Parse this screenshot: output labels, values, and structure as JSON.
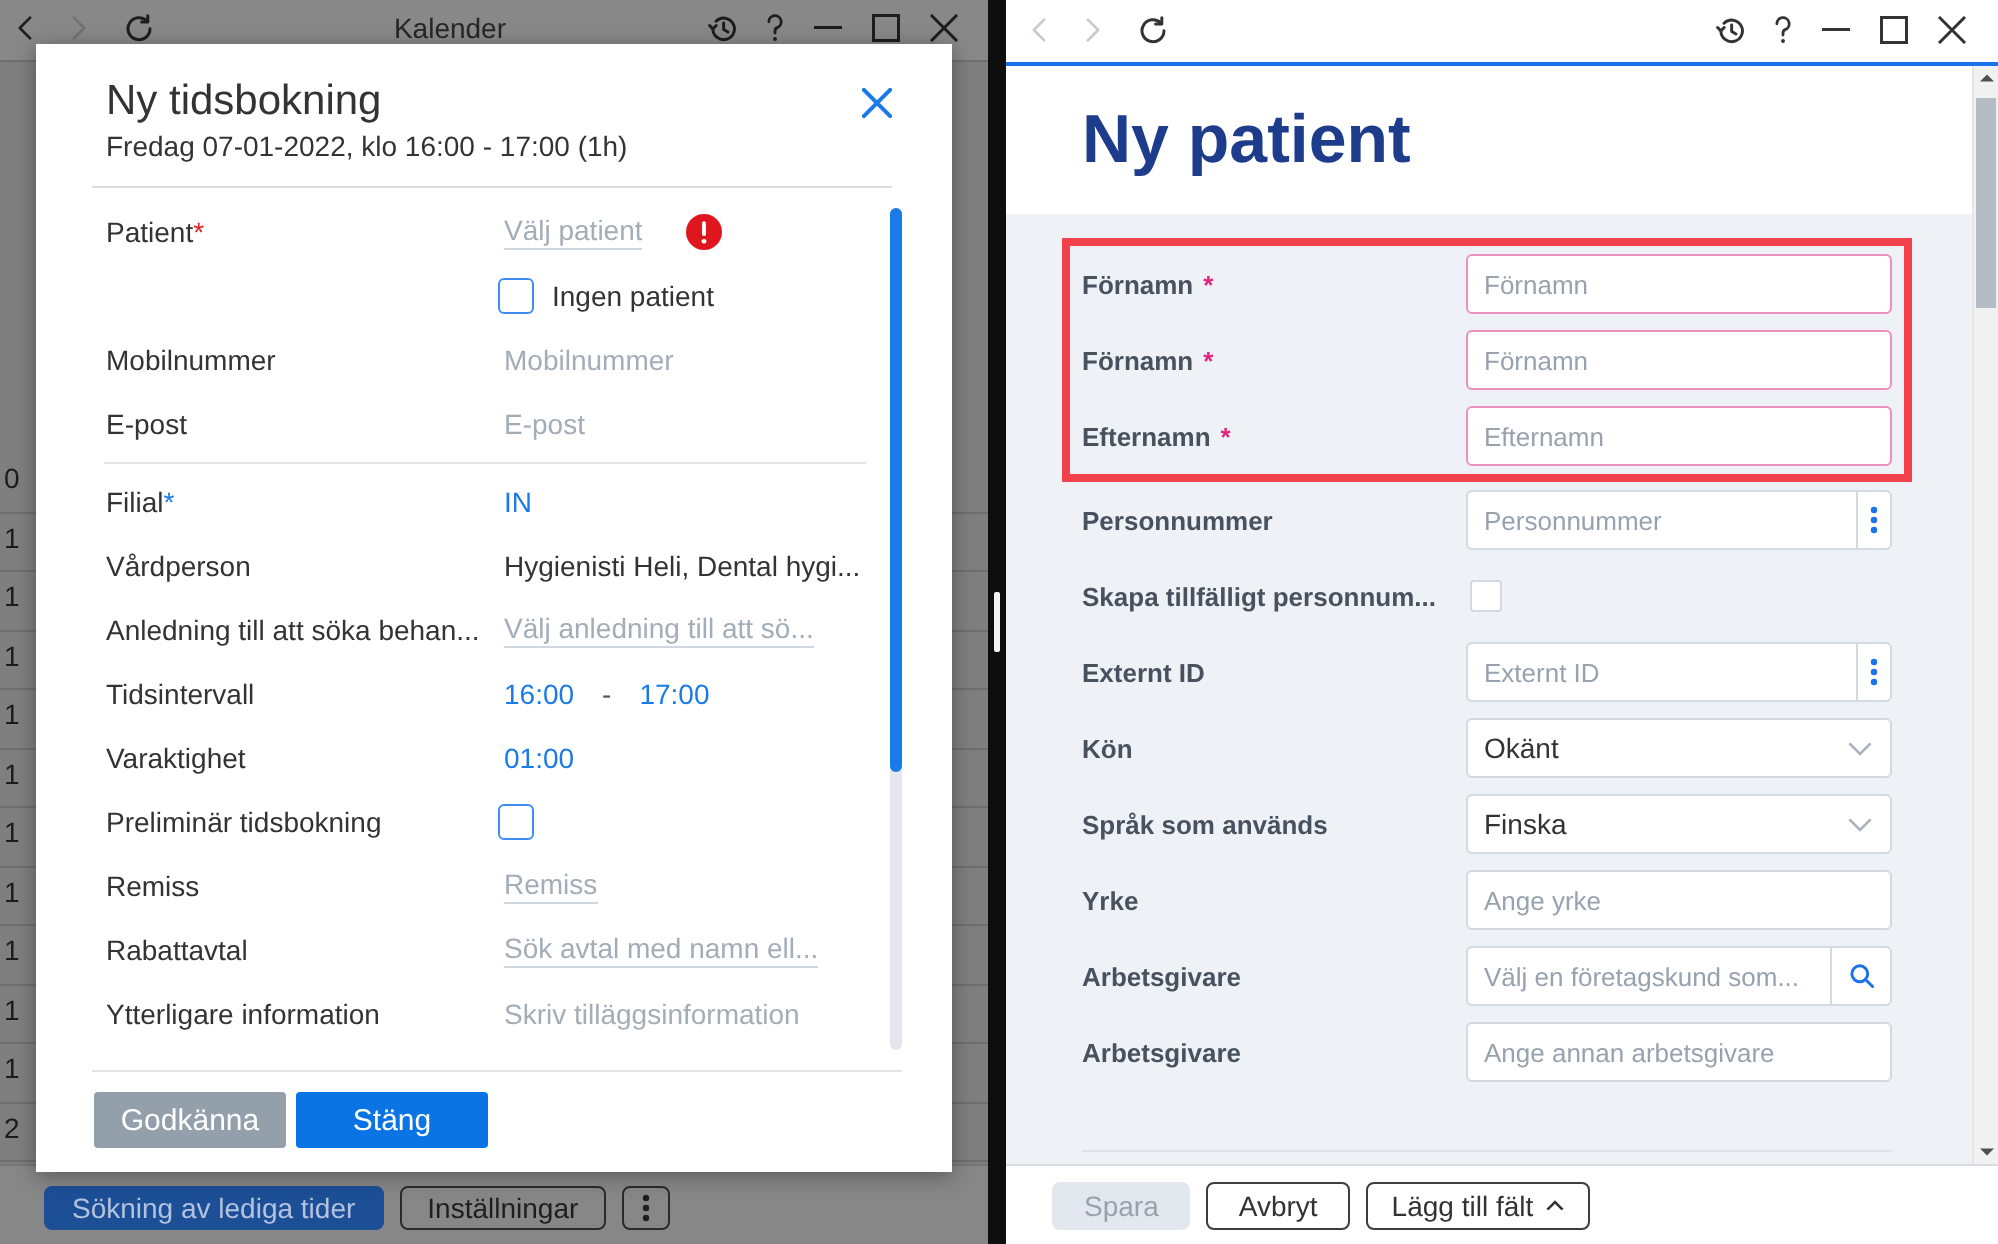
{
  "calendar_window": {
    "toolbar": {
      "back_disabled": false,
      "forward_disabled": true
    },
    "title": "Kalender",
    "time_labels": [
      "0",
      "1",
      "1",
      "1",
      "1",
      "1",
      "1",
      "1",
      "1",
      "1",
      "1",
      "2"
    ],
    "buttons": [
      {
        "kind": "primary",
        "label": "Sökning av lediga tider"
      },
      {
        "kind": "outline",
        "label": "Inställningar"
      },
      {
        "kind": "menu"
      }
    ]
  },
  "booking_dialog": {
    "title": "Ny tidsbokning",
    "subtitle": "Fredag 07-01-2022, klo 16:00 - 17:00 (1h)",
    "sections": [
      {
        "rows": [
          {
            "kind": "picker",
            "label": "Patient",
            "required_mark": "*",
            "error": true,
            "placeholder": "Välj patient"
          },
          {
            "kind": "checkbox",
            "text": "Ingen patient",
            "checked": false,
            "error": false
          },
          {
            "kind": "input",
            "label": "Mobilnummer",
            "error": false,
            "placeholder": "Mobilnummer"
          },
          {
            "kind": "input",
            "label": "E-post",
            "error": false,
            "placeholder": "E-post"
          }
        ]
      },
      {
        "rows": [
          {
            "kind": "link",
            "label": "Filial",
            "required_mark": "*",
            "error": false,
            "value": "IN"
          },
          {
            "kind": "text",
            "label": "Vårdperson",
            "error": false,
            "value": "Hygienisti Heli, Dental hygi..."
          },
          {
            "kind": "picker",
            "label": "Anledning till att söka behan...",
            "error": false,
            "placeholder": "Välj anledning till att sö..."
          },
          {
            "kind": "range",
            "label": "Tidsintervall",
            "error": false,
            "from": "16:00",
            "separator": "-",
            "to": "17:00"
          },
          {
            "kind": "link",
            "label": "Varaktighet",
            "error": false,
            "value": "01:00"
          },
          {
            "kind": "checkbox",
            "label": "Preliminär tidsbokning",
            "checked": false,
            "error": false
          },
          {
            "kind": "picker",
            "label": "Remiss",
            "error": false,
            "placeholder": "Remiss"
          },
          {
            "kind": "picker",
            "label": "Rabattavtal",
            "error": false,
            "placeholder": "Sök avtal med namn ell..."
          },
          {
            "kind": "input",
            "label": "Ytterligare information",
            "error": false,
            "placeholder": "Skriv tilläggsinformation"
          }
        ]
      }
    ],
    "buttons": [
      {
        "label": "Godkänna",
        "disabled": true
      },
      {
        "label": "Stäng",
        "disabled": false
      }
    ]
  },
  "patient_window": {
    "toolbar": {
      "back_disabled": true,
      "forward_disabled": true
    },
    "title": "Ny patient",
    "groups": [
      {
        "highlighted": true,
        "fields": [
          {
            "kind": "text",
            "label": "Förnamn",
            "required": true,
            "required_mark": "*",
            "placeholder": "Förnamn"
          },
          {
            "kind": "text",
            "label": "Förnamn",
            "required": true,
            "required_mark": "*",
            "placeholder": "Förnamn"
          },
          {
            "kind": "text",
            "label": "Efternamn",
            "required": true,
            "required_mark": "*",
            "placeholder": "Efternamn"
          }
        ]
      },
      {
        "highlighted": false,
        "fields": [
          {
            "kind": "text-menu",
            "label": "Personnummer",
            "required": false,
            "placeholder": "Personnummer"
          },
          {
            "kind": "checkbox",
            "label": "Skapa tillfälligt personnum...",
            "required": false,
            "checked": false
          },
          {
            "kind": "text-menu",
            "label": "Externt ID",
            "required": false,
            "placeholder": "Externt ID"
          },
          {
            "kind": "select",
            "label": "Kön",
            "required": false,
            "value": "Okänt"
          },
          {
            "kind": "select",
            "label": "Språk som används",
            "required": false,
            "value": "Finska"
          },
          {
            "kind": "text",
            "label": "Yrke",
            "required": false,
            "placeholder": "Ange yrke"
          },
          {
            "kind": "search",
            "label": "Arbetsgivare",
            "required": false,
            "placeholder": "Välj en företagskund som..."
          },
          {
            "kind": "text",
            "label": "Arbetsgivare",
            "required": false,
            "placeholder": "Ange annan arbetsgivare"
          }
        ]
      }
    ],
    "buttons": [
      {
        "kind": "plain",
        "label": "Spara",
        "disabled": true
      },
      {
        "kind": "plain",
        "label": "Avbryt",
        "disabled": false
      },
      {
        "kind": "dropdown",
        "label": "Lägg till fält",
        "disabled": false
      }
    ]
  }
}
